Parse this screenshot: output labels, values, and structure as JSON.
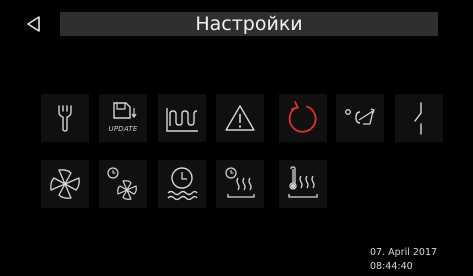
{
  "header": {
    "title": "Настройки",
    "back_icon": "back-triangle-icon"
  },
  "tiles_row1": [
    {
      "icon": "wrench-icon"
    },
    {
      "icon": "update-icon",
      "label": "UPDATE"
    },
    {
      "icon": "heating-curve-icon"
    },
    {
      "icon": "warning-icon"
    },
    {
      "icon": "reset-icon",
      "color": "#e0302a"
    },
    {
      "icon": "temperature-switch-icon"
    },
    {
      "icon": "contact-switch-icon"
    }
  ],
  "tiles_row2": [
    {
      "icon": "fan-icon"
    },
    {
      "icon": "fan-timer-icon"
    },
    {
      "icon": "water-timer-icon"
    },
    {
      "icon": "heat-timer-icon"
    },
    {
      "icon": "heat-temperature-icon"
    }
  ],
  "status": {
    "date": "07. April 2017",
    "time": "08:44:40"
  },
  "colors": {
    "background": "#000000",
    "title_bar": "#2f2f2f",
    "tile_bg": "#101010",
    "icon_stroke": "#d6d6d6",
    "accent_red": "#e0302a"
  }
}
